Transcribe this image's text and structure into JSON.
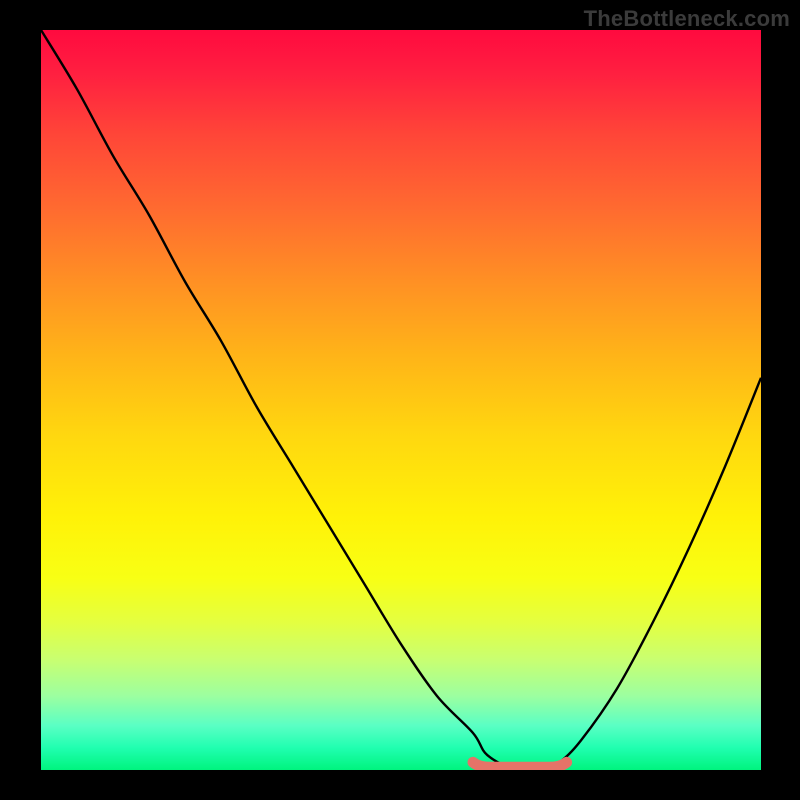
{
  "watermark": "TheBottleneck.com",
  "colors": {
    "frame_bg": "#000000",
    "watermark_text": "#3b3b3b",
    "curve_stroke": "#000000",
    "marker_stroke": "#e57368",
    "gradient_top": "#ff0a3f",
    "gradient_bottom": "#00f47e"
  },
  "chart_data": {
    "type": "line",
    "title": "",
    "xlabel": "",
    "ylabel": "",
    "xlim": [
      0,
      100
    ],
    "ylim": [
      0,
      100
    ],
    "grid": false,
    "series": [
      {
        "name": "bottleneck-curve",
        "x": [
          0,
          5,
          10,
          15,
          20,
          25,
          30,
          35,
          40,
          45,
          50,
          55,
          60,
          62,
          66,
          70,
          72,
          75,
          80,
          85,
          90,
          95,
          100
        ],
        "y": [
          100,
          92,
          83,
          75,
          66,
          58,
          49,
          41,
          33,
          25,
          17,
          10,
          5,
          2,
          0,
          0,
          1,
          4,
          11,
          20,
          30,
          41,
          53
        ]
      }
    ],
    "annotations": [
      {
        "name": "optimal-range-marker",
        "x_start": 60,
        "x_end": 73,
        "y": 0.5,
        "color": "#e57368"
      }
    ],
    "background": {
      "type": "vertical-gradient",
      "meaning": "red (high bottleneck) at top to green (no bottleneck) at bottom"
    }
  }
}
